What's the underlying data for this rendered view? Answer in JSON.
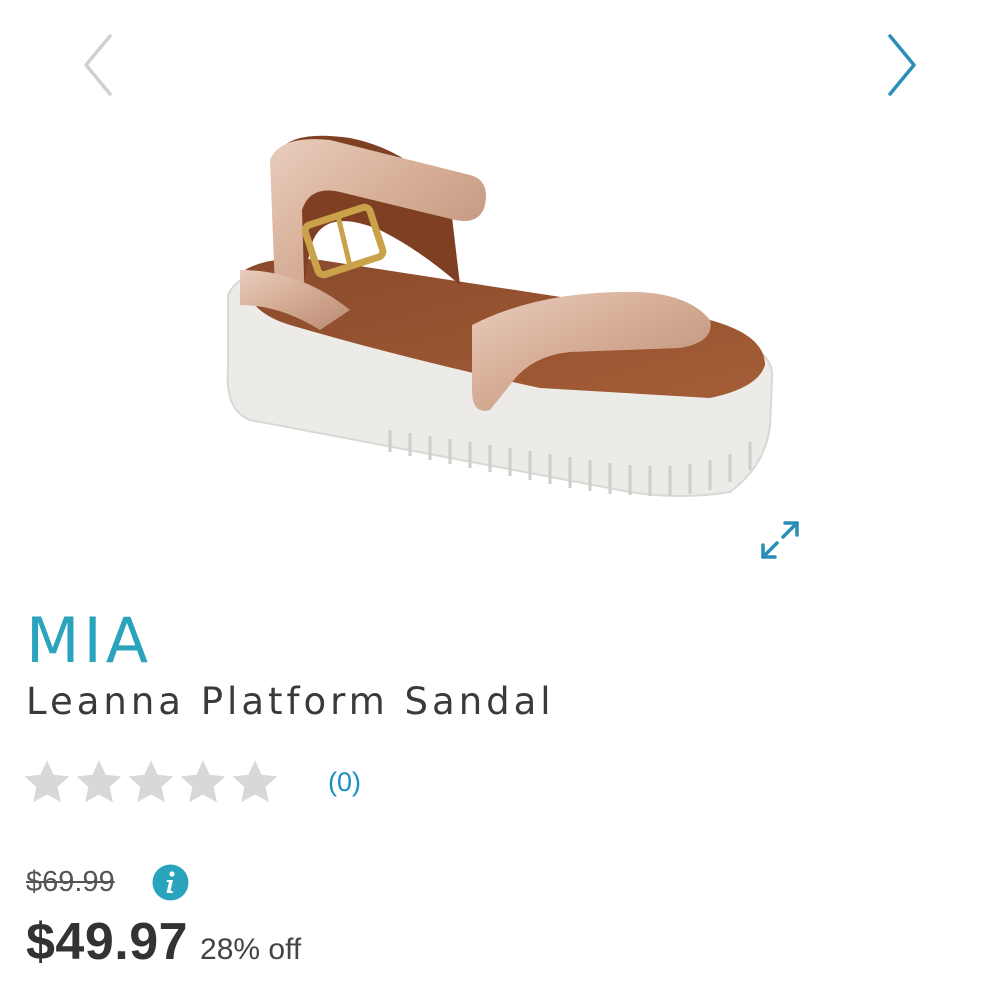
{
  "gallery": {
    "prev_icon": "chevron-left-icon",
    "next_icon": "chevron-right-icon",
    "expand_icon": "expand-icon",
    "arrow_inactive_color": "#cfcfcf",
    "arrow_active_color": "#2a8fb8"
  },
  "product": {
    "brand": "MIA",
    "name": "Leanna Platform Sandal",
    "brand_color": "#2aa3bd"
  },
  "rating": {
    "stars_filled": 0,
    "stars_total": 5,
    "review_count": "(0)"
  },
  "pricing": {
    "original_price": "$69.99",
    "sale_price": "$49.97",
    "discount": "28% off",
    "info_icon": "info-icon",
    "info_color": "#2aa3bd"
  }
}
